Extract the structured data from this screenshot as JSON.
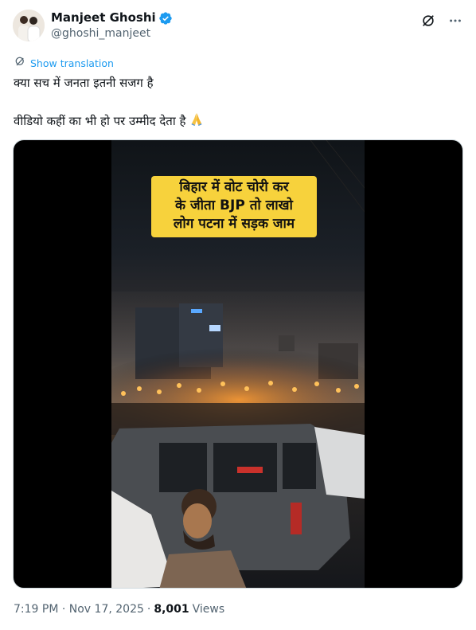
{
  "author": {
    "display_name": "Manjeet Ghoshi",
    "handle": "@ghoshi_manjeet",
    "verified": true,
    "verified_color": "#1d9bf0"
  },
  "actions": {
    "grok_icon": "slash-circle-icon",
    "more_icon": "more-dots-icon"
  },
  "translation": {
    "label": "Show translation"
  },
  "tweet": {
    "line1": "क्या सच में जनता इतनी सजग है",
    "line2": "वीडियो कहीं का भी हो पर उम्मीद देता है"
  },
  "video": {
    "caption_line1": "बिहार में वोट चोरी कर",
    "caption_line2": "के जीता BJP तो लाखो",
    "caption_line3": "लोग पटना में सड़क जाम"
  },
  "meta": {
    "timestamp": "7:19 PM · Nov 17, 2025",
    "separator": "·",
    "views_count": "8,001",
    "views_label": "Views"
  }
}
